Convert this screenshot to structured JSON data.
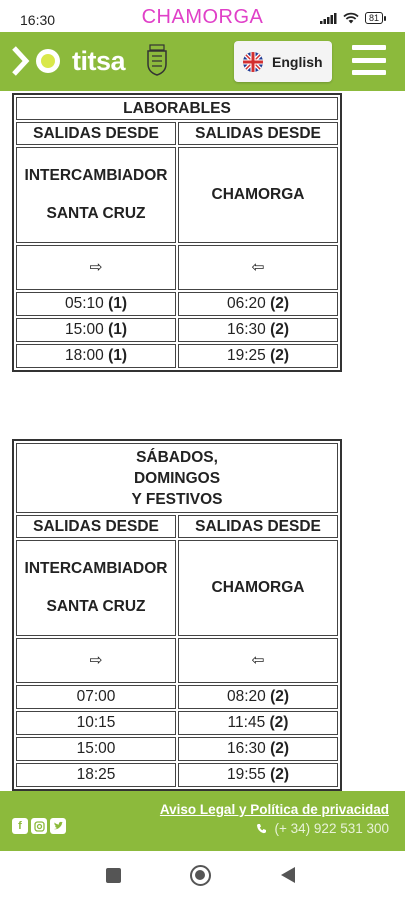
{
  "status_bar": {
    "time": "16:30",
    "title": "CHAMORGA",
    "battery": "81"
  },
  "header": {
    "logo_text": "titsa",
    "language_label": "English"
  },
  "schedules": [
    {
      "title_lines": [
        "LABORABLES"
      ],
      "columns": [
        "SALIDAS DESDE",
        "SALIDAS DESDE"
      ],
      "from": [
        "INTERCAMBIADOR",
        "SANTA CRUZ"
      ],
      "to": "CHAMORGA",
      "arrow_out": "⇨",
      "arrow_back": "⇦",
      "rows": [
        {
          "out_time": "05:10",
          "out_note": "(1)",
          "back_time": "06:20",
          "back_note": "(2)"
        },
        {
          "out_time": "15:00",
          "out_note": "(1)",
          "back_time": "16:30",
          "back_note": "(2)"
        },
        {
          "out_time": "18:00",
          "out_note": "(1)",
          "back_time": "19:25",
          "back_note": "(2)"
        }
      ]
    },
    {
      "title_lines": [
        "SÁBADOS,",
        "DOMINGOS",
        "Y FESTIVOS"
      ],
      "columns": [
        "SALIDAS DESDE",
        "SALIDAS DESDE"
      ],
      "from": [
        "INTERCAMBIADOR",
        "SANTA CRUZ"
      ],
      "to": "CHAMORGA",
      "arrow_out": "⇨",
      "arrow_back": "⇦",
      "rows": [
        {
          "out_time": "07:00",
          "out_note": "",
          "back_time": "08:20",
          "back_note": "(2)"
        },
        {
          "out_time": "10:15",
          "out_note": "",
          "back_time": "11:45",
          "back_note": "(2)"
        },
        {
          "out_time": "15:00",
          "out_note": "",
          "back_time": "16:30",
          "back_note": "(2)"
        },
        {
          "out_time": "18:25",
          "out_note": "",
          "back_time": "19:55",
          "back_note": "(2)"
        }
      ]
    }
  ],
  "footer": {
    "legal_link": "Aviso Legal y Política de privacidad",
    "phone": "(+ 34) 922 531 300",
    "social_icons": [
      "facebook-icon",
      "instagram-icon",
      "twitter-icon"
    ]
  },
  "colors": {
    "brand_green": "#8cba3c",
    "title_pink": "#e040c8"
  }
}
